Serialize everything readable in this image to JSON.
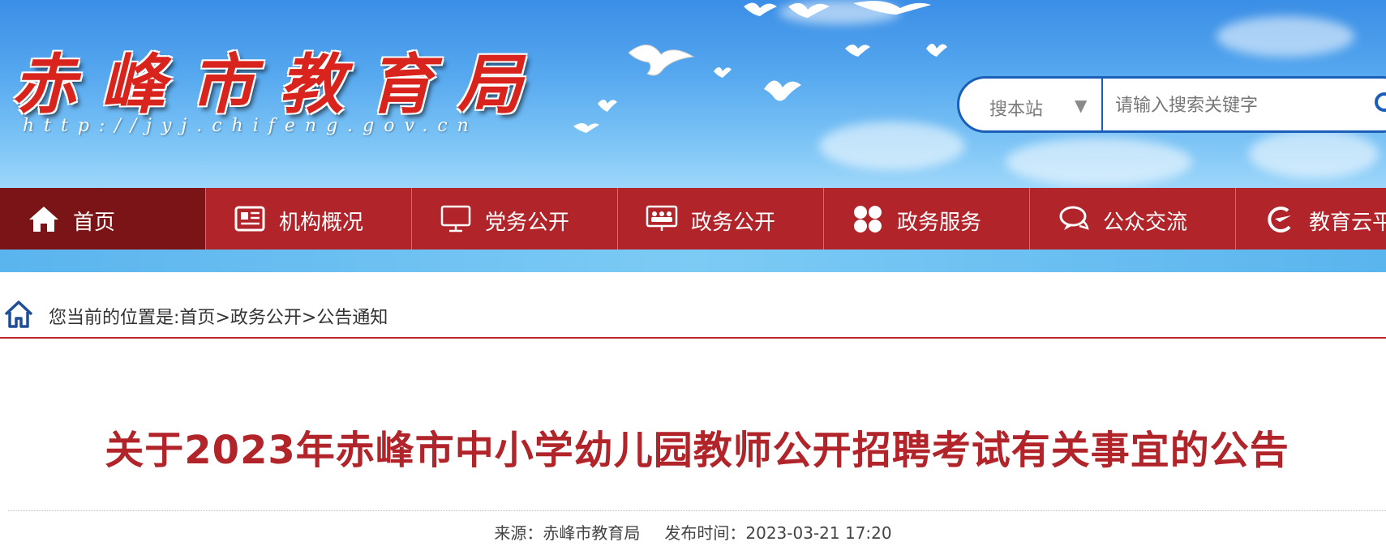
{
  "header": {
    "site_title": "赤峰市教育局",
    "site_url": "http://jyj.chifeng.gov.cn"
  },
  "search": {
    "scope_label": "搜本站",
    "scope_arrow": "▼",
    "placeholder": "请输入搜索关键字"
  },
  "nav": {
    "items": [
      {
        "label": "首页",
        "icon": "home-icon",
        "active": true
      },
      {
        "label": "机构概况",
        "icon": "newspaper-icon"
      },
      {
        "label": "党务公开",
        "icon": "monitor-icon"
      },
      {
        "label": "政务公开",
        "icon": "presentation-icon"
      },
      {
        "label": "政务服务",
        "icon": "grid-icon"
      },
      {
        "label": "公众交流",
        "icon": "chat-icon"
      },
      {
        "label": "教育云平",
        "icon": "cloud-logo-icon"
      }
    ]
  },
  "breadcrumb": {
    "prefix": "您当前的位置是:",
    "items": [
      "首页",
      "政务公开",
      "公告通知"
    ],
    "separator": ">"
  },
  "article": {
    "title": "关于2023年赤峰市中小学幼儿园教师公开招聘考试有关事宜的公告",
    "source_label": "来源：",
    "source": "赤峰市教育局",
    "published_label": "发布时间：",
    "published": "2023-03-21 17:20"
  },
  "colors": {
    "nav_background": "#b0242a",
    "nav_active": "#7a1416",
    "title_red": "#b0242a",
    "search_border": "#1c5fb8",
    "banner_sky": "#56a8ef"
  }
}
